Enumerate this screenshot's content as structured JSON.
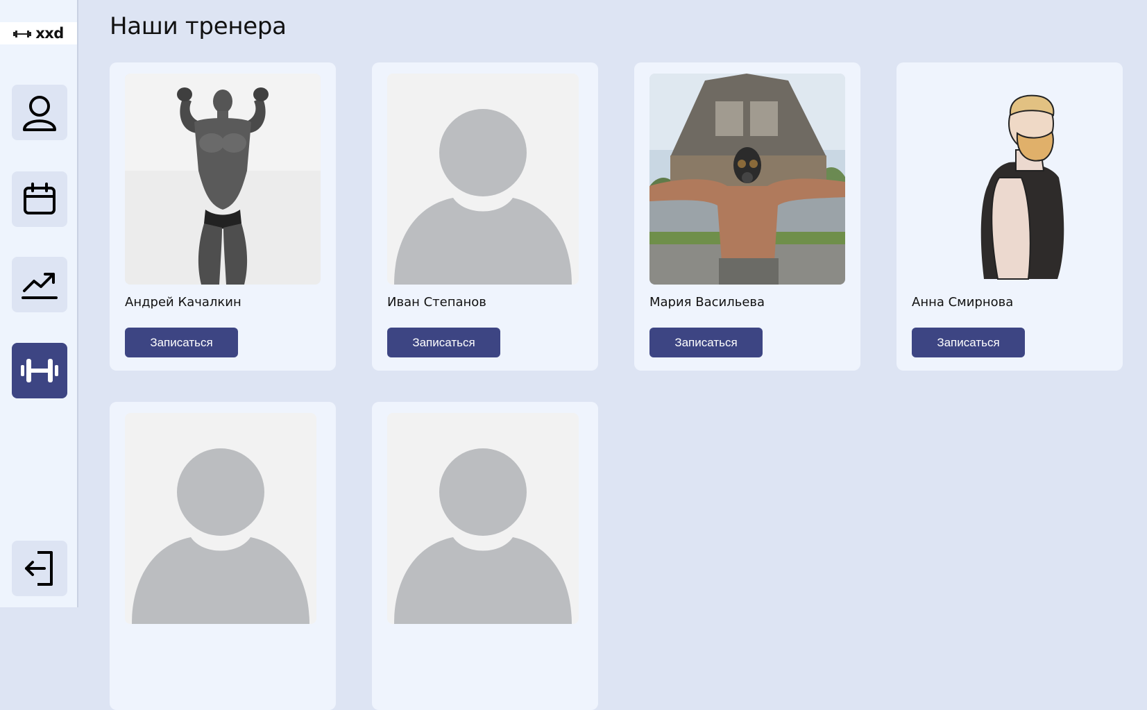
{
  "logo": {
    "text": "xxd",
    "icon": "dumbbell-icon"
  },
  "sidebar": {
    "items": [
      {
        "name": "profile",
        "icon": "user-icon",
        "active": false
      },
      {
        "name": "schedule",
        "icon": "calendar-icon",
        "active": false
      },
      {
        "name": "progress",
        "icon": "chart-up-icon",
        "active": false
      },
      {
        "name": "trainers",
        "icon": "dumbbell-icon",
        "active": true
      }
    ],
    "logout": {
      "icon": "logout-icon"
    }
  },
  "page": {
    "title": "Наши тренера"
  },
  "trainers": [
    {
      "name": "Андрей Качалкин",
      "button_label": "Записаться",
      "photo": "bodybuilder-photo"
    },
    {
      "name": "Иван Степанов",
      "button_label": "Записаться",
      "photo": "avatar-placeholder"
    },
    {
      "name": "Мария Васильева",
      "button_label": "Записаться",
      "photo": "gas-mask-man-photo"
    },
    {
      "name": "Анна Смирнова",
      "button_label": "Записаться",
      "photo": "bearded-man-drawing"
    },
    {
      "name": "",
      "button_label": "",
      "photo": "avatar-placeholder"
    },
    {
      "name": "",
      "button_label": "",
      "photo": "avatar-placeholder"
    }
  ],
  "colors": {
    "accent": "#3d4583",
    "background": "#dde4f3",
    "card": "#eff4fd",
    "placeholder": "#bbbdc0"
  }
}
